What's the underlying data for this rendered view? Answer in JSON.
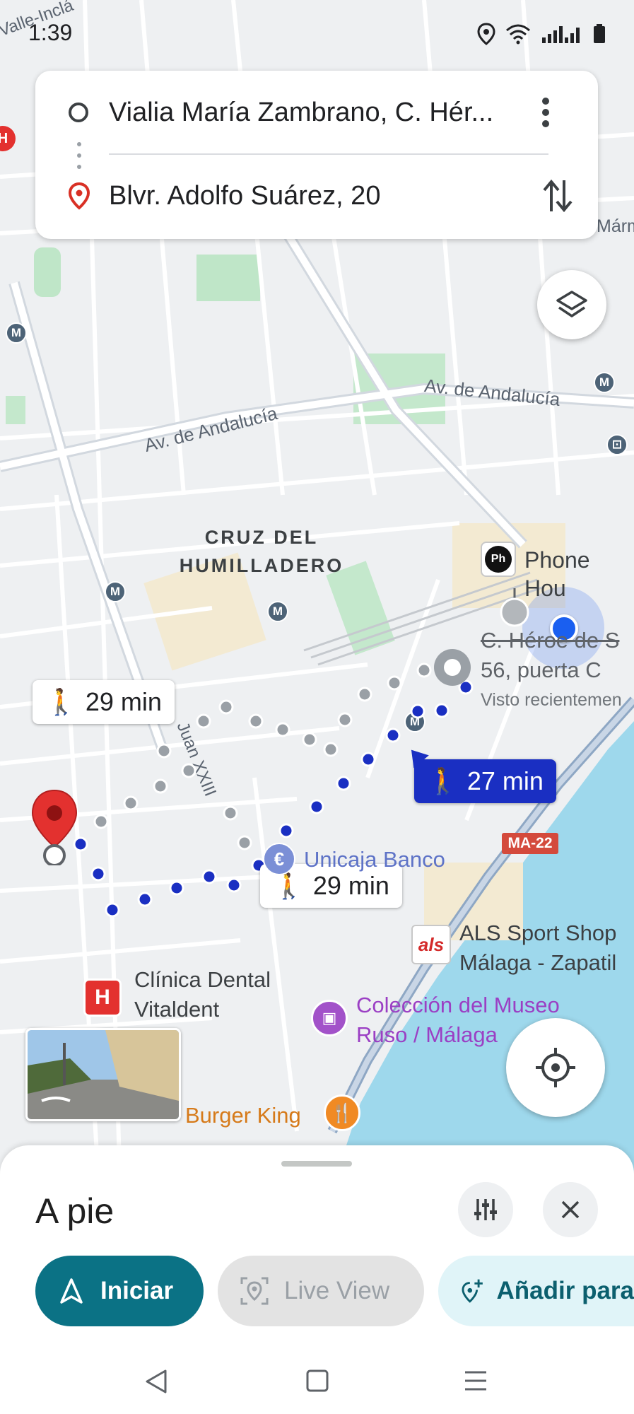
{
  "status_bar": {
    "time": "1:39"
  },
  "directions": {
    "origin": "Vialia María Zambrano, C. Hér...",
    "destination": "Blvr. Adolfo Suárez, 20"
  },
  "map": {
    "corner_label": "Valle-Inclá",
    "corner_label_right": "Márm",
    "street_1": "Av. de Andalucía",
    "street_2": "Av. de Andalucía",
    "street_3": "Juan XXIII",
    "district": "CRUZ DEL\nHUMILLADERO",
    "highway": "MA-22",
    "routes": [
      {
        "label": "29 min",
        "active": false
      },
      {
        "label": "27 min",
        "active": true
      },
      {
        "label": "29 min",
        "active": false
      }
    ],
    "pois": {
      "phone_house": "Phone Hou",
      "heroes_line1": "C. Héroe de S",
      "heroes_line2": "56, puerta C",
      "heroes_sub": "Visto recientemen",
      "unicaja": "Unicaja Banco",
      "als_line1": "ALS Sport Shop",
      "als_line2": "Málaga - Zapatil",
      "als_logo": "als",
      "dental_line1": "Clínica Dental",
      "dental_line2": "Vitaldent",
      "museo_line1": "Colección del Museo",
      "museo_line2": "Ruso / Málaga",
      "burger": "Burger King",
      "phone_logo": "Ph"
    }
  },
  "sheet": {
    "mode_title": "A pie",
    "start_label": "Iniciar",
    "liveview_label": "Live View",
    "add_label": "Añadir para"
  },
  "colors": {
    "accent_teal": "#0b7285",
    "route_blue": "#1a2fc2",
    "pin_red": "#e3312f"
  }
}
